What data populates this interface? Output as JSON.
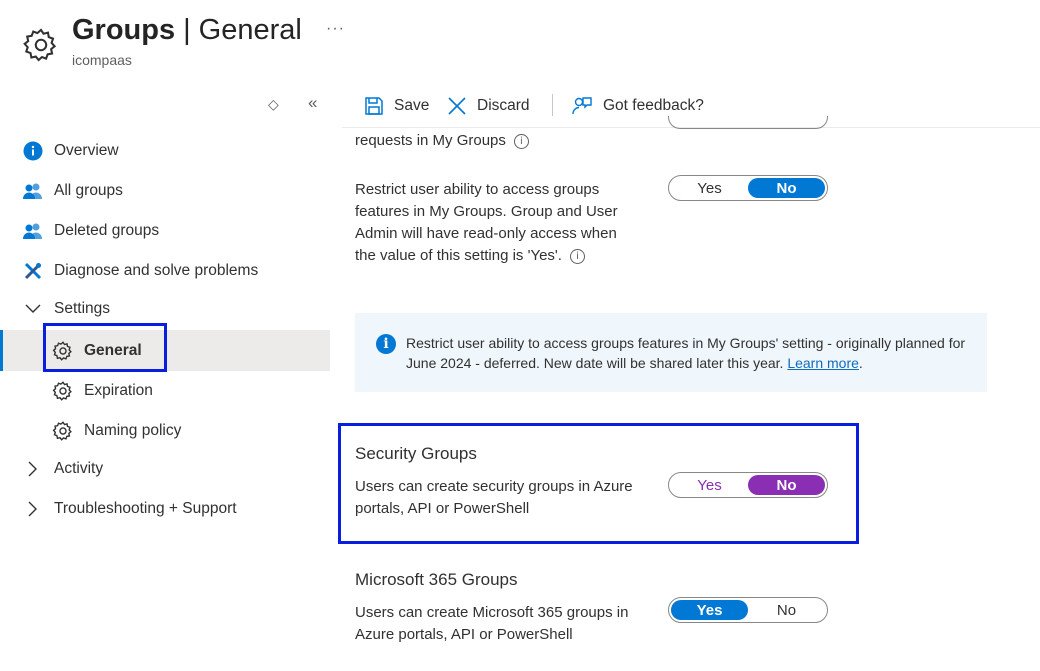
{
  "header": {
    "title_bold": "Groups",
    "separator": "|",
    "title_rest": "General",
    "subtitle": "icompaas",
    "more": "···",
    "icon": "gear-icon"
  },
  "sidebar": {
    "sort_icon": "◇",
    "collapse_icon": "«",
    "items": [
      {
        "label": "Overview",
        "icon": "info-icon"
      },
      {
        "label": "All groups",
        "icon": "users-icon"
      },
      {
        "label": "Deleted groups",
        "icon": "users-icon"
      },
      {
        "label": "Diagnose and solve problems",
        "icon": "wrench-icon"
      },
      {
        "label": "Settings",
        "icon": "chevron-down-icon"
      },
      {
        "label": "General",
        "icon": "gear-icon"
      },
      {
        "label": "Expiration",
        "icon": "gear-icon"
      },
      {
        "label": "Naming policy",
        "icon": "gear-icon"
      },
      {
        "label": "Activity",
        "icon": "chevron-right-icon"
      },
      {
        "label": "Troubleshooting + Support",
        "icon": "chevron-right-icon"
      }
    ]
  },
  "toolbar": {
    "save_label": "Save",
    "discard_label": "Discard",
    "feedback_label": "Got feedback?"
  },
  "content": {
    "partial_text": "requests in My Groups",
    "restrict": {
      "line1": "Restrict user ability to access groups",
      "line2": "features in My Groups. Group and User",
      "line3": "Admin will have read-only access when",
      "line4": "the value of this setting is 'Yes'.",
      "yes": "Yes",
      "no": "No",
      "selected": "No"
    },
    "banner": {
      "text": "Restrict user ability to access groups features in My Groups' setting - originally planned for June 2024 - deferred. New date will be shared later this year.",
      "link": "Learn more",
      "end": "."
    },
    "security": {
      "title": "Security Groups",
      "line1": "Users can create security groups in Azure",
      "line2": "portals, API or PowerShell",
      "yes": "Yes",
      "no": "No",
      "selected": "No"
    },
    "m365": {
      "title": "Microsoft 365 Groups",
      "line1": "Users can create Microsoft 365 groups in",
      "line2": "Azure portals, API or PowerShell",
      "yes": "Yes",
      "no": "No",
      "selected": "Yes"
    }
  },
  "colors": {
    "accent": "#0078d4",
    "highlight_border": "#0a1ee0",
    "security_toggle": "#8a2fb4"
  }
}
